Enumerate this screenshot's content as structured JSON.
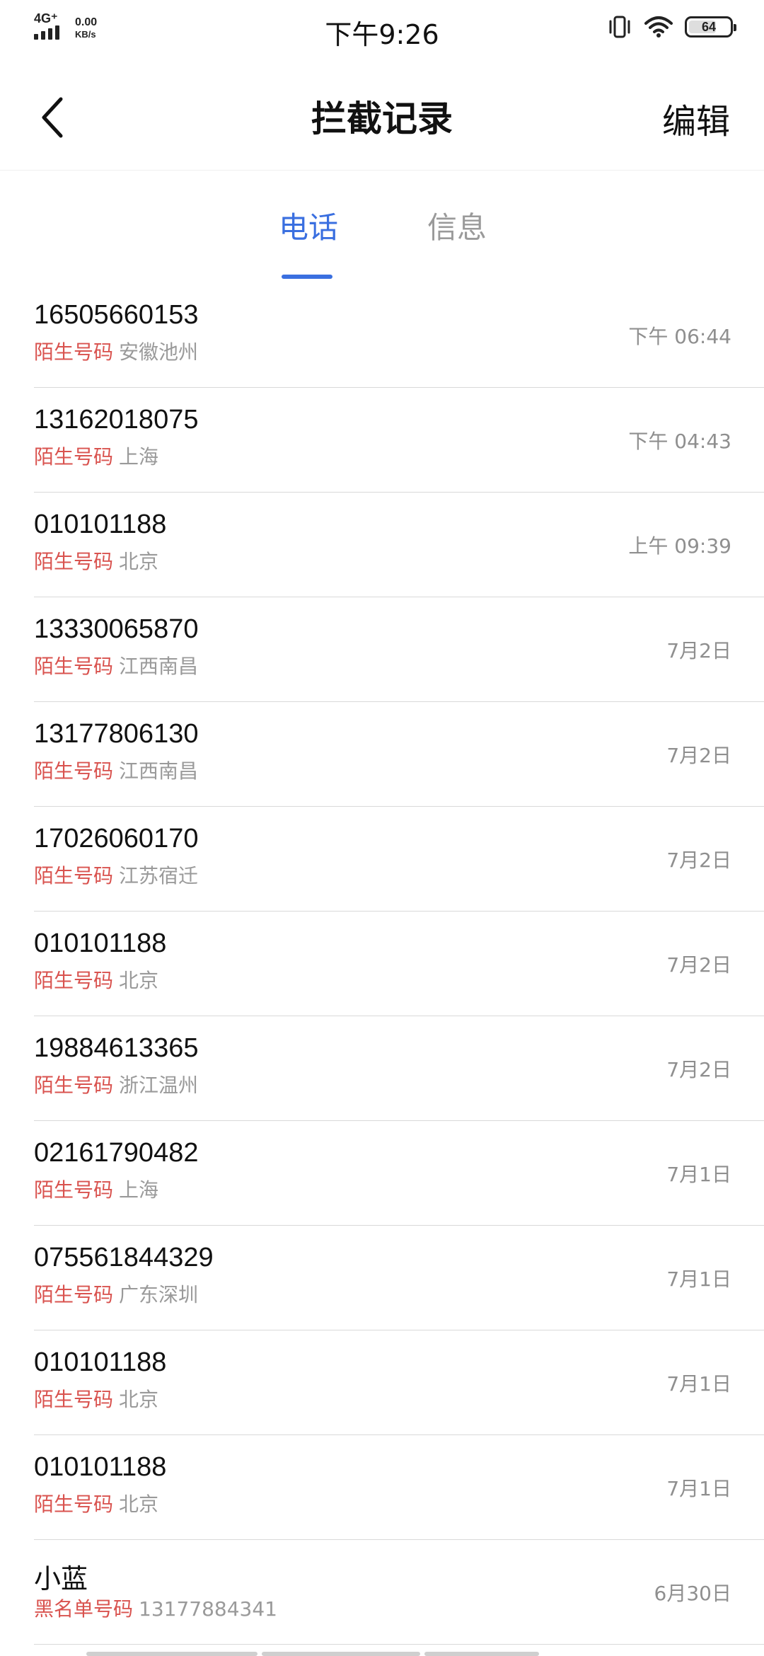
{
  "status_bar": {
    "network": "4G⁺",
    "speed_value": "0.00",
    "speed_unit": "KB/s",
    "time": "下午9:26",
    "battery": "64",
    "battery_level": 0.64
  },
  "header": {
    "title": "拦截记录",
    "edit_label": "编辑",
    "back_icon": "chevron-left-icon"
  },
  "tabs": [
    {
      "label": "电话",
      "active": true
    },
    {
      "label": "信息",
      "active": false
    }
  ],
  "records": [
    {
      "number": "16505660153",
      "tag": "陌生号码",
      "info": "安徽池州",
      "time": "下午 06:44"
    },
    {
      "number": "13162018075",
      "tag": "陌生号码",
      "info": "上海",
      "time": "下午 04:43"
    },
    {
      "number": "010101188",
      "tag": "陌生号码",
      "info": "北京",
      "time": "上午 09:39"
    },
    {
      "number": "13330065870",
      "tag": "陌生号码",
      "info": "江西南昌",
      "time": "7月2日"
    },
    {
      "number": "13177806130",
      "tag": "陌生号码",
      "info": "江西南昌",
      "time": "7月2日"
    },
    {
      "number": "17026060170",
      "tag": "陌生号码",
      "info": "江苏宿迁",
      "time": "7月2日"
    },
    {
      "number": "010101188",
      "tag": "陌生号码",
      "info": "北京",
      "time": "7月2日"
    },
    {
      "number": "19884613365",
      "tag": "陌生号码",
      "info": "浙江温州",
      "time": "7月2日"
    },
    {
      "number": "02161790482",
      "tag": "陌生号码",
      "info": "上海",
      "time": "7月1日"
    },
    {
      "number": "075561844329",
      "tag": "陌生号码",
      "info": "广东深圳",
      "time": "7月1日"
    },
    {
      "number": "010101188",
      "tag": "陌生号码",
      "info": "北京",
      "time": "7月1日"
    },
    {
      "number": "010101188",
      "tag": "陌生号码",
      "info": "北京",
      "time": "7月1日"
    },
    {
      "number": "小蓝",
      "tag": "黑名单号码",
      "info": "13177884341",
      "time": "6月30日"
    }
  ],
  "colors": {
    "accent": "#3a6fe0",
    "tag_red": "#d9534f",
    "muted": "#9a9a9a"
  }
}
